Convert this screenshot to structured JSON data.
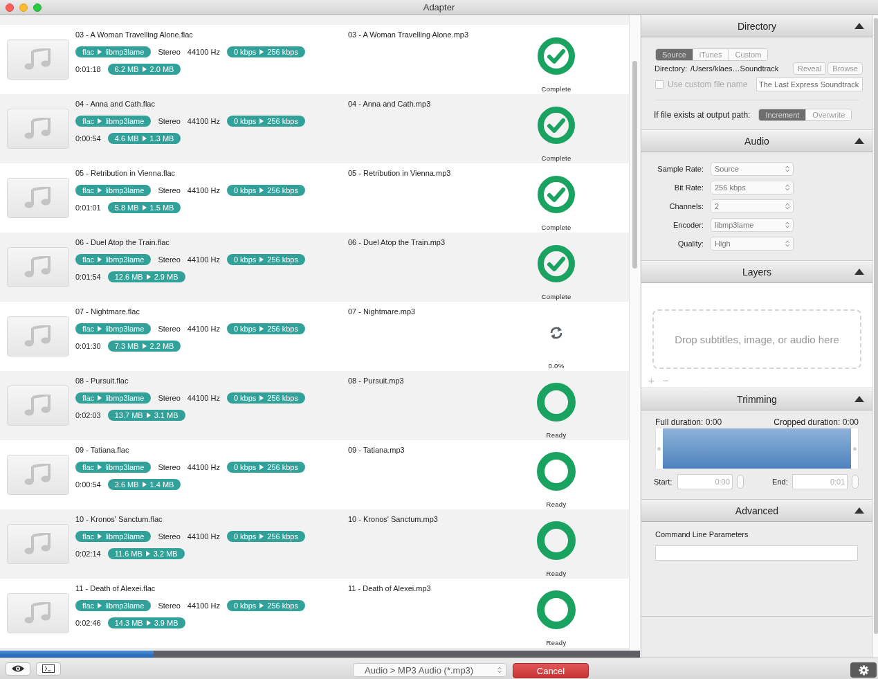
{
  "window": {
    "title": "Adapter"
  },
  "tracks": [
    {
      "input_name": "03 - A Woman Travelling Alone.flac",
      "output_name": "03 - A Woman Travelling Alone.mp3",
      "codec_from": "flac",
      "codec_to": "libmp3lame",
      "channels": "Stereo",
      "sample_rate": "44100 Hz",
      "bitrate_from": "0 kbps",
      "bitrate_to": "256 kbps",
      "duration": "0:01:18",
      "size_from": "6.2 MB",
      "size_to": "2.0 MB",
      "kind": "complete",
      "status_label": "Complete"
    },
    {
      "input_name": "04 - Anna and Cath.flac",
      "output_name": "04 - Anna and Cath.mp3",
      "codec_from": "flac",
      "codec_to": "libmp3lame",
      "channels": "Stereo",
      "sample_rate": "44100 Hz",
      "bitrate_from": "0 kbps",
      "bitrate_to": "256 kbps",
      "duration": "0:00:54",
      "size_from": "4.6 MB",
      "size_to": "1.3 MB",
      "kind": "complete",
      "status_label": "Complete"
    },
    {
      "input_name": "05 - Retribution in Vienna.flac",
      "output_name": "05 - Retribution in Vienna.mp3",
      "codec_from": "flac",
      "codec_to": "libmp3lame",
      "channels": "Stereo",
      "sample_rate": "44100 Hz",
      "bitrate_from": "0 kbps",
      "bitrate_to": "256 kbps",
      "duration": "0:01:01",
      "size_from": "5.8 MB",
      "size_to": "1.5 MB",
      "kind": "complete",
      "status_label": "Complete"
    },
    {
      "input_name": "06 - Duel Atop the Train.flac",
      "output_name": "06 - Duel Atop the Train.mp3",
      "codec_from": "flac",
      "codec_to": "libmp3lame",
      "channels": "Stereo",
      "sample_rate": "44100 Hz",
      "bitrate_from": "0 kbps",
      "bitrate_to": "256 kbps",
      "duration": "0:01:54",
      "size_from": "12.6 MB",
      "size_to": "2.9 MB",
      "kind": "complete",
      "status_label": "Complete"
    },
    {
      "input_name": "07 - Nightmare.flac",
      "output_name": "07 - Nightmare.mp3",
      "codec_from": "flac",
      "codec_to": "libmp3lame",
      "channels": "Stereo",
      "sample_rate": "44100 Hz",
      "bitrate_from": "0 kbps",
      "bitrate_to": "256 kbps",
      "duration": "0:01:30",
      "size_from": "7.3 MB",
      "size_to": "2.2 MB",
      "kind": "converting",
      "status_label": "0.0%"
    },
    {
      "input_name": "08 - Pursuit.flac",
      "output_name": "08 - Pursuit.mp3",
      "codec_from": "flac",
      "codec_to": "libmp3lame",
      "channels": "Stereo",
      "sample_rate": "44100 Hz",
      "bitrate_from": "0 kbps",
      "bitrate_to": "256 kbps",
      "duration": "0:02:03",
      "size_from": "13.7 MB",
      "size_to": "3.1 MB",
      "kind": "ready",
      "status_label": "Ready"
    },
    {
      "input_name": "09 - Tatiana.flac",
      "output_name": "09 - Tatiana.mp3",
      "codec_from": "flac",
      "codec_to": "libmp3lame",
      "channels": "Stereo",
      "sample_rate": "44100 Hz",
      "bitrate_from": "0 kbps",
      "bitrate_to": "256 kbps",
      "duration": "0:00:54",
      "size_from": "3.6 MB",
      "size_to": "1.4 MB",
      "kind": "ready",
      "status_label": "Ready"
    },
    {
      "input_name": "10 - Kronos' Sanctum.flac",
      "output_name": "10 - Kronos' Sanctum.mp3",
      "codec_from": "flac",
      "codec_to": "libmp3lame",
      "channels": "Stereo",
      "sample_rate": "44100 Hz",
      "bitrate_from": "0 kbps",
      "bitrate_to": "256 kbps",
      "duration": "0:02:14",
      "size_from": "11.6 MB",
      "size_to": "3.2 MB",
      "kind": "ready",
      "status_label": "Ready"
    },
    {
      "input_name": "11 - Death of Alexei.flac",
      "output_name": "11 - Death of Alexei.mp3",
      "codec_from": "flac",
      "codec_to": "libmp3lame",
      "channels": "Stereo",
      "sample_rate": "44100 Hz",
      "bitrate_from": "0 kbps",
      "bitrate_to": "256 kbps",
      "duration": "0:02:46",
      "size_from": "14.3 MB",
      "size_to": "3.9 MB",
      "kind": "ready",
      "status_label": "Ready"
    }
  ],
  "overall_progress": {
    "level": 0.24
  },
  "sidebar": {
    "directory": {
      "title": "Directory",
      "expanded": true,
      "location_tabs": [
        {
          "label": "Source",
          "selected": true
        },
        {
          "label": "iTunes",
          "selected": false
        },
        {
          "label": "Custom",
          "selected": false
        }
      ],
      "directory_label": "Directory:",
      "directory_path": "/Users/klaes…Soundtrack",
      "reveal_button": "Reveal",
      "browse_button": "Browse",
      "custom_name": {
        "label": "Use custom file name",
        "checked": false,
        "value": "The Last Express Soundtrack"
      },
      "exists_label": "If file exists at output path:",
      "exists_options": [
        {
          "label": "Increment",
          "selected": true
        },
        {
          "label": "Overwrite",
          "selected": false
        }
      ]
    },
    "audio": {
      "title": "Audio",
      "expanded": true,
      "settings": [
        {
          "label": "Sample Rate:",
          "value": "Source"
        },
        {
          "label": "Bit Rate:",
          "value": "256 kbps"
        },
        {
          "label": "Channels:",
          "value": "2"
        },
        {
          "label": "Encoder:",
          "value": "libmp3lame"
        },
        {
          "label": "Quality:",
          "value": "High"
        }
      ]
    },
    "layers": {
      "title": "Layers",
      "expanded": true,
      "drop_hint": "Drop subtitles, image, or audio here",
      "add_button": "+",
      "remove_button": "−"
    },
    "trimming": {
      "title": "Trimming",
      "expanded": true,
      "full_duration": "Full duration: 0:00",
      "cropped_duration": "Cropped duration: 0:00",
      "start_label": "Start:",
      "start_value": "0:00",
      "end_label": "End:",
      "end_value": "0:01"
    },
    "advanced": {
      "title": "Advanced",
      "expanded": true,
      "params_label": "Command Line Parameters"
    }
  },
  "bottom_bar": {
    "preset": "Audio > MP3 Audio (*.mp3)",
    "cancel_button": "Cancel"
  }
}
